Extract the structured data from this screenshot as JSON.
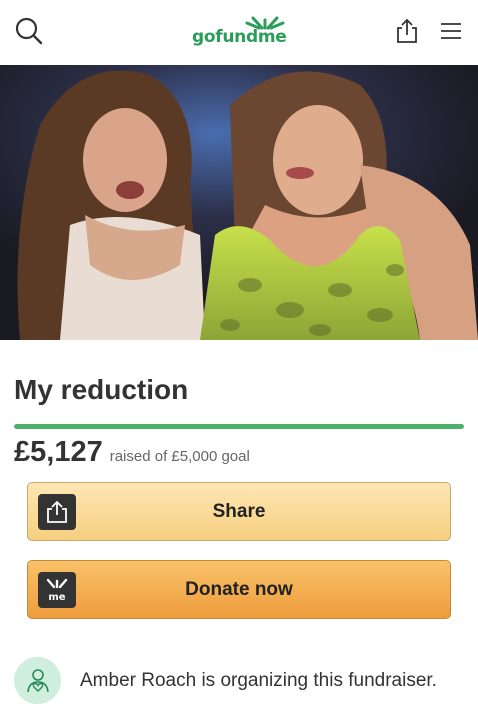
{
  "header": {
    "logo_text": "gofundme",
    "icons": {
      "search": "search-icon",
      "share": "share-icon",
      "menu": "menu-icon"
    },
    "brand_color": "#2a9d58"
  },
  "campaign": {
    "title": "My reduction",
    "amount_raised": "£5,127",
    "raised_label": "raised of £5,000 goal",
    "progress_percent": 100,
    "progress_color": "#4caf6a"
  },
  "buttons": {
    "share_label": "Share",
    "donate_label": "Donate now",
    "donate_icon_text": "me"
  },
  "organizer": {
    "text": "Amber Roach is organizing this fundraiser.",
    "avatar_color": "#cfeedd"
  }
}
